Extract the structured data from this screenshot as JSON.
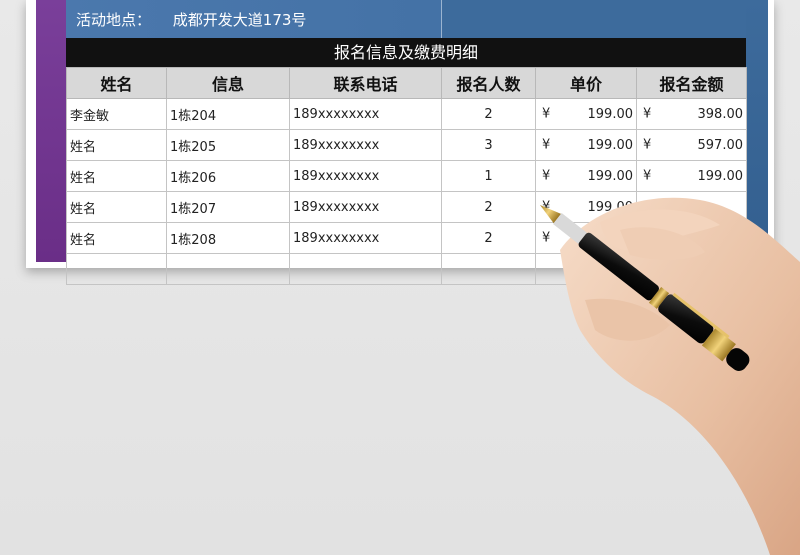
{
  "event": {
    "location_label": "活动地点：",
    "location_value": "成都开发大道173号"
  },
  "section_title": "报名信息及缴费明细",
  "table": {
    "headers": [
      "姓名",
      "信息",
      "联系电话",
      "报名人数",
      "单价",
      "报名金额"
    ],
    "currency_symbol": "¥",
    "rows": [
      {
        "name": "李金敏",
        "info": "1栋204",
        "phone": "189xxxxxxxx",
        "count": "2",
        "price": "199.00",
        "amount": "398.00"
      },
      {
        "name": "姓名",
        "info": "1栋205",
        "phone": "189xxxxxxxx",
        "count": "3",
        "price": "199.00",
        "amount": "597.00"
      },
      {
        "name": "姓名",
        "info": "1栋206",
        "phone": "189xxxxxxxx",
        "count": "1",
        "price": "199.00",
        "amount": "199.00"
      },
      {
        "name": "姓名",
        "info": "1栋207",
        "phone": "189xxxxxxxx",
        "count": "2",
        "price": "199.00",
        "amount": ""
      },
      {
        "name": "姓名",
        "info": "1栋208",
        "phone": "189xxxxxxxx",
        "count": "2",
        "price": "",
        "amount": ""
      }
    ]
  },
  "colors": {
    "header_blue": "#3d6b9c",
    "side_purple": "#6a2e87",
    "title_bar": "#111111",
    "header_cell": "#d8d8d8"
  },
  "icons": {
    "pen": "fountain-pen-in-hand"
  }
}
